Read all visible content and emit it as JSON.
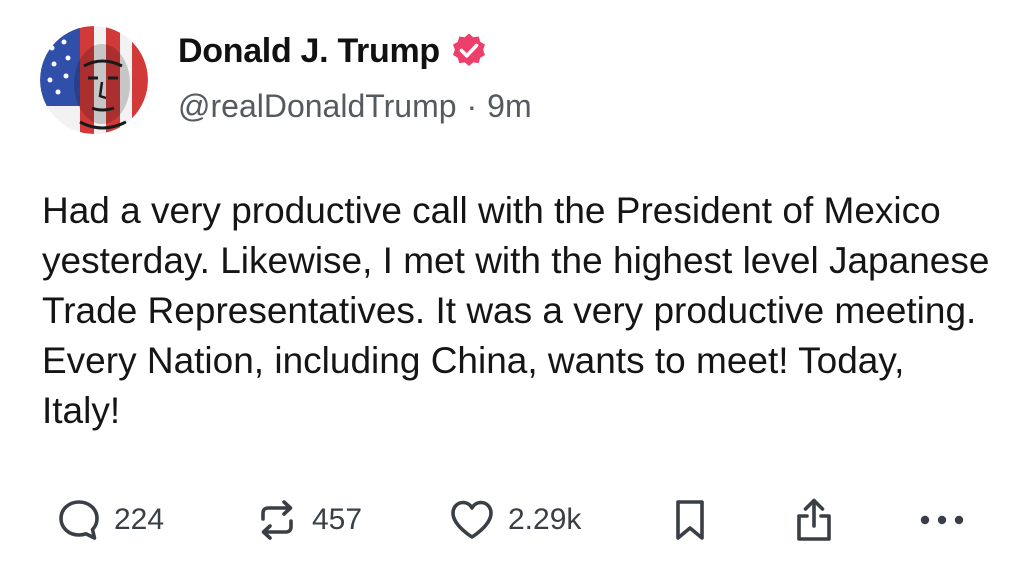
{
  "author": {
    "display_name": "Donald J. Trump",
    "handle": "@realDonaldTrump",
    "separator": "·",
    "time_ago": "9m",
    "verified": true,
    "verified_color": "#ee3e6b"
  },
  "post": {
    "text": "Had a very productive call with the President of Mexico yesterday. Likewise, I met with the highest level Japanese Trade Representatives. It was a very productive meeting. Every Nation, including China, wants to meet! Today, Italy!"
  },
  "actions": {
    "reply": {
      "icon": "reply-icon",
      "count": "224"
    },
    "repost": {
      "icon": "repost-icon",
      "count": "457"
    },
    "like": {
      "icon": "heart-icon",
      "count": "2.29k"
    },
    "bookmark": {
      "icon": "bookmark-icon"
    },
    "share": {
      "icon": "share-icon"
    },
    "more": {
      "icon": "more-icon"
    }
  }
}
